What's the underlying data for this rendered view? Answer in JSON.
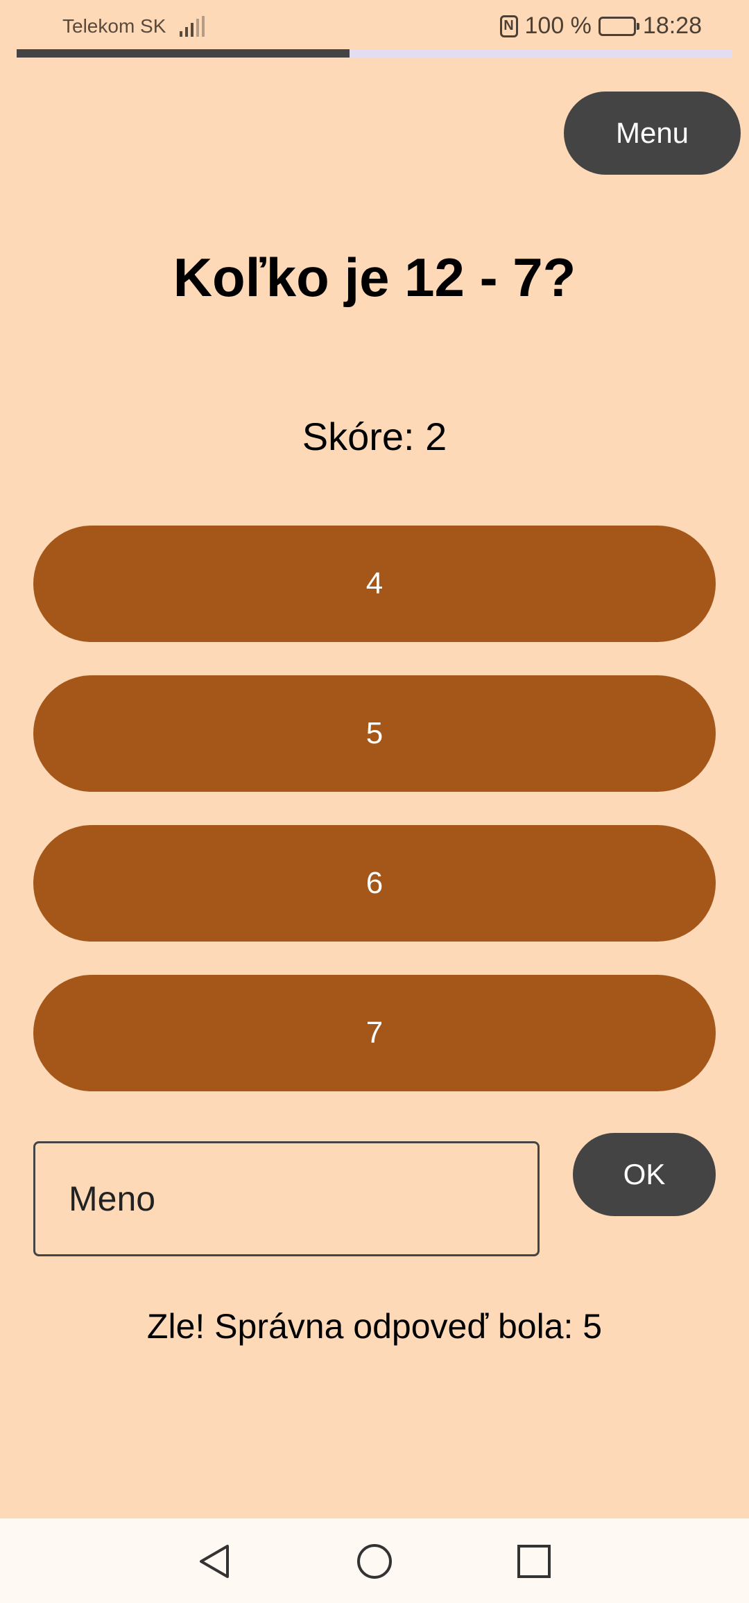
{
  "status_bar": {
    "carrier": "Telekom SK",
    "battery": "100 %",
    "time": "18:28",
    "icons": [
      "signal-icon",
      "nfc-icon",
      "battery-icon"
    ]
  },
  "progress": {
    "fraction": 0.465
  },
  "header": {
    "menu_label": "Menu"
  },
  "quiz": {
    "question": "Koľko je 12 - 7?",
    "score_text": "Skóre: 2",
    "answers": [
      {
        "label": "4"
      },
      {
        "label": "5"
      },
      {
        "label": "6"
      },
      {
        "label": "7"
      }
    ],
    "name_input": {
      "placeholder": "Meno",
      "value": ""
    },
    "ok_label": "OK",
    "feedback": "Zle! Správna odpoveď bola: 5"
  },
  "nav_bar": {
    "buttons": [
      "back-icon",
      "home-icon",
      "recents-icon"
    ]
  },
  "colors": {
    "background": "#fdd9b8",
    "answer_button": "#a45719",
    "dark_button": "#444444",
    "progress_track": "#e2ddf0"
  }
}
